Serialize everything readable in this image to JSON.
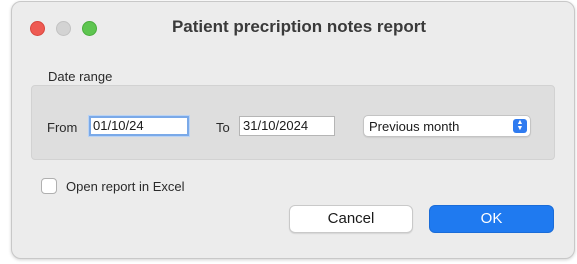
{
  "window": {
    "title": "Patient precription notes report"
  },
  "date_range": {
    "group_label": "Date range",
    "from_label": "From",
    "from_value": "01/10/24",
    "to_label": "To",
    "to_value": "31/10/2024",
    "preset_selected": "Previous month"
  },
  "options": {
    "open_in_excel_label": "Open report in Excel",
    "open_in_excel_checked": false
  },
  "buttons": {
    "cancel_label": "Cancel",
    "ok_label": "OK"
  },
  "colors": {
    "accent": "#1f7af0",
    "close": "#ee5a52",
    "minimize": "#d3d3d3",
    "maximize": "#5ec550"
  }
}
